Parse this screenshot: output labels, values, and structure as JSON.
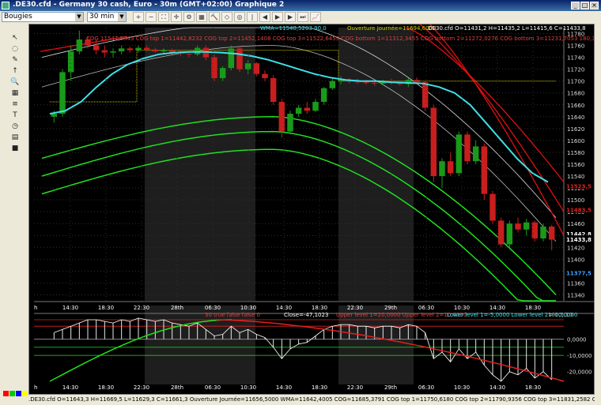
{
  "window": {
    "title": ".DE30.cfd - Germany 30 cash, Euro - 30m (GMT+02:00)  Graphique 2",
    "buttons": [
      "_",
      "□",
      "×"
    ]
  },
  "toolbar": {
    "chart_type": "Bougies",
    "timeframe": "30 min",
    "icons": [
      "zoom-in-icon",
      "zoom-out-icon",
      "full-chart-icon",
      "crosshair-icon",
      "settings-icon",
      "grid-icon",
      "hammer-icon",
      "objects-icon",
      "target-icon",
      "step-icon",
      "left-icon",
      "play-icon",
      "right-icon",
      "end-icon",
      "chart-icon"
    ]
  },
  "left_tools": [
    "cursor-icon",
    "circle-tool-icon",
    "pencil-icon",
    "arrow-up-icon",
    "magnifier-icon",
    "grid-tool-icon",
    "ruler-icon",
    "text-tool-icon",
    "clock-icon",
    "calculator-icon",
    "box-icon"
  ],
  "colors": {
    "background": "#000000",
    "bull": "#1a9a1a",
    "bear": "#c81e1e",
    "wma": "#40e0e8",
    "cog_top": "#e01010",
    "cog_bottom": "#20e020",
    "opening": "#c8c800",
    "grid": "#303030"
  },
  "chart": {
    "legend": {
      "cog_main": "COG 11547,5843 COG top 1=11442,8232 COG top 2=11452,1408 COG top 3=11522,6459 COG bottom 1=11312,3455 COG bottom 2=11272,0276 COG bottom 3=11231,7053 180,3,1,61803399",
      "wma": "WMA=11540,5203 90,0",
      "opening": "Ouverture Journée=11694,6000",
      "ohlc": ".DE30.cfd O=11431,2 H=11435,2 L=11415,6 C=11433,8"
    },
    "y_labels": [
      "11780",
      "11760",
      "11740",
      "11720",
      "11700",
      "11680",
      "11660",
      "11640",
      "11620",
      "11600",
      "11580",
      "11560",
      "11540",
      "11520",
      "11500",
      "11480",
      "11460",
      "11440",
      "11420",
      "11400",
      "11380",
      "11360",
      "11340"
    ],
    "price_tags": [
      {
        "text": "11523,5",
        "color": "#e02020",
        "value": 11523.5
      },
      {
        "text": "11483,5",
        "color": "#e02020",
        "value": 11483.5
      },
      {
        "text": "11442,8",
        "color": "#ffffff",
        "value": 11442.8
      },
      {
        "text": "11433,8",
        "color": "#ffffff",
        "value": 11433.8
      },
      {
        "text": "11377,5",
        "color": "#40a0ff",
        "value": 11377.5
      }
    ],
    "x_labels": [
      "14:30",
      "18:30",
      "22:30",
      "28th",
      "06:30",
      "10:30",
      "14:30",
      "18:30",
      "22:30",
      "29th",
      "06:30",
      "10:30",
      "14:30",
      "18:30"
    ],
    "h_label": "h"
  },
  "indicator": {
    "legend_a": "30 true false false 0",
    "legend_close": "Close=-47,1023",
    "legend_upper": "Upper level 1=20,0000 Upper level 2=10,0000",
    "legend_lower": "Lower level 1=-5,0000 Lower level 2=-10,0000",
    "legend_tail": "100,5,10",
    "y_labels": [
      "0,0000",
      "-10,0000",
      "-20,0000"
    ],
    "x_labels": [
      "14:30",
      "18:30",
      "22:30",
      "28th",
      "06:30",
      "10:30",
      "14:30",
      "18:30",
      "22:30",
      "29th",
      "06:30",
      "10:30",
      "14:30",
      "18:30"
    ],
    "h_label": "h"
  },
  "status": {
    "text": ".DE30.cfd O=11643,3 H=11669,5 L=11629,3 C=11661,3   Ouverture Journée=11656,5000 WMA=11642,4005 COG=11685,3791 COG top 1=11750,6180 COG top 2=11790,9356 COG top 3=11831,2582 COG bottom 1=11"
  },
  "chart_data": {
    "type": "candlestick",
    "ylim": [
      11330,
      11790
    ],
    "candles": [
      [
        11640,
        11650,
        11630,
        11645
      ],
      [
        11645,
        11720,
        11640,
        11715
      ],
      [
        11715,
        11760,
        11700,
        11750
      ],
      [
        11750,
        11785,
        11745,
        11770
      ],
      [
        11770,
        11775,
        11755,
        11760
      ],
      [
        11760,
        11770,
        11745,
        11752
      ],
      [
        11752,
        11760,
        11740,
        11748
      ],
      [
        11748,
        11755,
        11740,
        11750
      ],
      [
        11750,
        11760,
        11745,
        11755
      ],
      [
        11755,
        11758,
        11748,
        11752
      ],
      [
        11752,
        11760,
        11748,
        11756
      ],
      [
        11756,
        11760,
        11750,
        11753
      ],
      [
        11753,
        11756,
        11748,
        11750
      ],
      [
        11750,
        11755,
        11745,
        11752
      ],
      [
        11752,
        11755,
        11745,
        11748
      ],
      [
        11748,
        11752,
        11742,
        11746
      ],
      [
        11746,
        11750,
        11740,
        11745
      ],
      [
        11745,
        11760,
        11742,
        11756
      ],
      [
        11756,
        11760,
        11735,
        11740
      ],
      [
        11740,
        11745,
        11700,
        11705
      ],
      [
        11705,
        11725,
        11700,
        11722
      ],
      [
        11722,
        11760,
        11718,
        11755
      ],
      [
        11755,
        11760,
        11715,
        11720
      ],
      [
        11720,
        11735,
        11712,
        11730
      ],
      [
        11730,
        11732,
        11708,
        11712
      ],
      [
        11712,
        11718,
        11700,
        11705
      ],
      [
        11705,
        11710,
        11660,
        11665
      ],
      [
        11665,
        11670,
        11605,
        11615
      ],
      [
        11615,
        11650,
        11610,
        11645
      ],
      [
        11645,
        11660,
        11640,
        11655
      ],
      [
        11655,
        11665,
        11645,
        11650
      ],
      [
        11650,
        11670,
        11648,
        11665
      ],
      [
        11665,
        11690,
        11660,
        11688
      ],
      [
        11688,
        11705,
        11685,
        11700
      ],
      [
        11700,
        11708,
        11695,
        11702
      ],
      [
        11702,
        11705,
        11696,
        11700
      ],
      [
        11700,
        11704,
        11695,
        11698
      ],
      [
        11698,
        11702,
        11694,
        11697
      ],
      [
        11697,
        11700,
        11692,
        11696
      ],
      [
        11696,
        11702,
        11693,
        11700
      ],
      [
        11700,
        11704,
        11694,
        11698
      ],
      [
        11698,
        11700,
        11692,
        11695
      ],
      [
        11695,
        11705,
        11690,
        11702
      ],
      [
        11702,
        11706,
        11696,
        11698
      ],
      [
        11698,
        11700,
        11650,
        11655
      ],
      [
        11655,
        11660,
        11530,
        11540
      ],
      [
        11540,
        11570,
        11520,
        11565
      ],
      [
        11565,
        11580,
        11540,
        11545
      ],
      [
        11545,
        11615,
        11540,
        11610
      ],
      [
        11610,
        11615,
        11560,
        11565
      ],
      [
        11565,
        11600,
        11560,
        11590
      ],
      [
        11590,
        11595,
        11500,
        11510
      ],
      [
        11510,
        11515,
        11460,
        11465
      ],
      [
        11465,
        11470,
        11420,
        11425
      ],
      [
        11425,
        11465,
        11420,
        11460
      ],
      [
        11460,
        11470,
        11445,
        11450
      ],
      [
        11450,
        11468,
        11440,
        11462
      ],
      [
        11462,
        11465,
        11430,
        11435
      ],
      [
        11435,
        11460,
        11430,
        11455
      ],
      [
        11455,
        11458,
        11415,
        11433
      ]
    ],
    "osc": [
      4,
      6,
      8,
      10,
      12,
      12,
      11,
      10,
      12,
      11,
      13,
      12,
      11,
      12,
      10,
      9,
      8,
      10,
      6,
      2,
      3,
      8,
      4,
      6,
      3,
      1,
      -5,
      -12,
      -6,
      -3,
      -2,
      2,
      6,
      8,
      9,
      9,
      8,
      8,
      7,
      8,
      8,
      7,
      9,
      8,
      4,
      -12,
      -8,
      -14,
      -6,
      -12,
      -8,
      -16,
      -22,
      -26,
      -20,
      -22,
      -18,
      -24,
      -20,
      -25
    ],
    "cog_upper_curves": [
      [
        11800,
        11700
      ],
      [
        11830,
        11740
      ],
      [
        11860,
        11800
      ]
    ],
    "cog_lower_curves": [
      [
        11620,
        11420
      ],
      [
        11580,
        11380
      ],
      [
        11540,
        11340
      ]
    ]
  }
}
